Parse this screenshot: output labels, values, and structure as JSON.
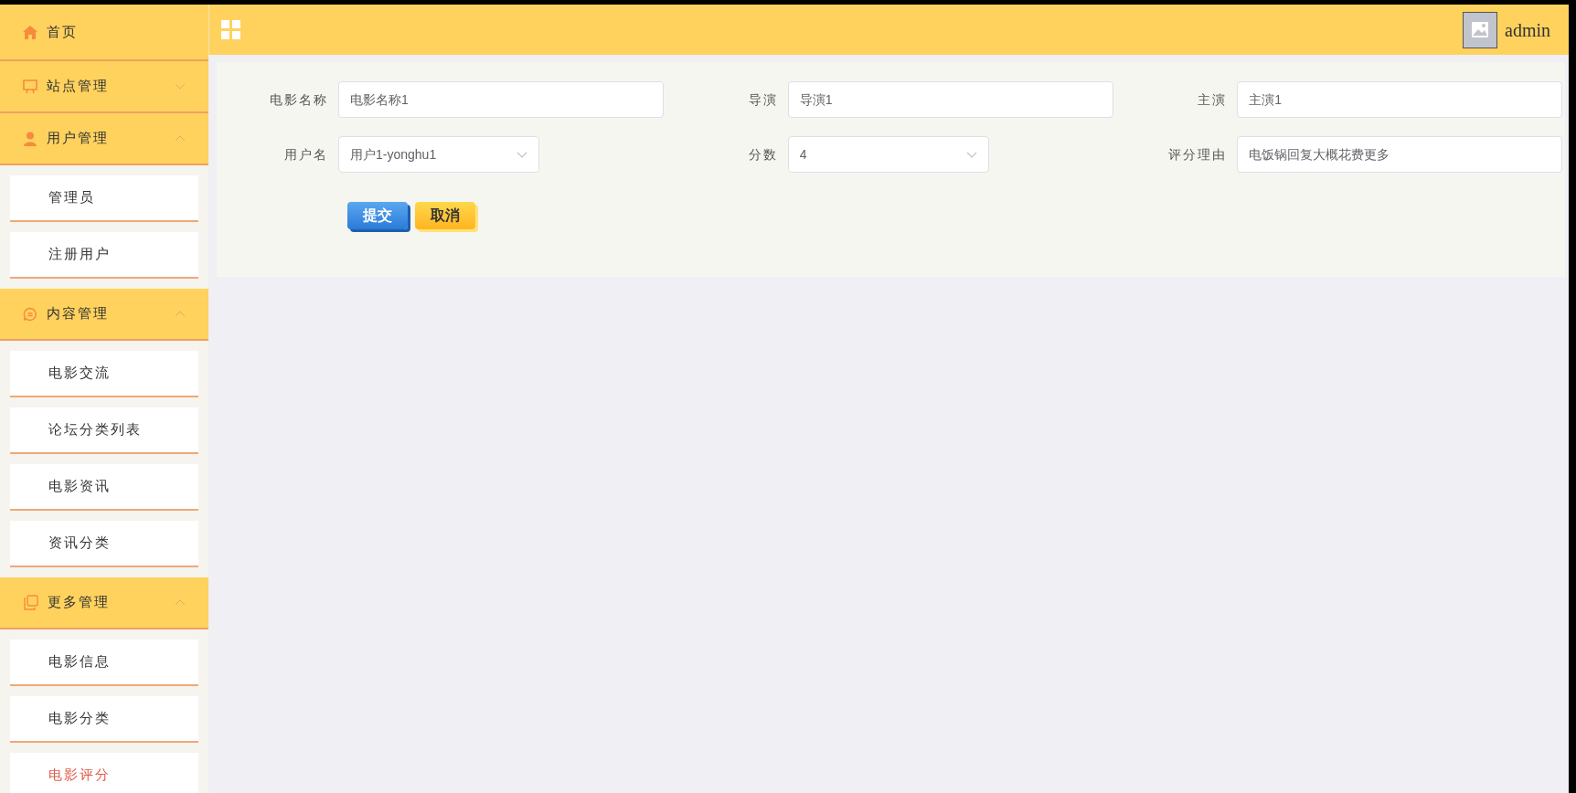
{
  "sidebar": {
    "items": [
      {
        "kind": "link",
        "label": "首页"
      },
      {
        "kind": "group",
        "label": "站点管理",
        "expanded": false
      },
      {
        "kind": "group",
        "label": "用户管理",
        "expanded": true,
        "children": [
          {
            "label": "管理员",
            "selected": false
          },
          {
            "label": "注册用户",
            "selected": false
          }
        ]
      },
      {
        "kind": "group",
        "label": "内容管理",
        "expanded": true,
        "children": [
          {
            "label": "电影交流",
            "selected": false
          },
          {
            "label": "论坛分类列表",
            "selected": false
          },
          {
            "label": "电影资讯",
            "selected": false
          },
          {
            "label": "资讯分类",
            "selected": false
          }
        ]
      },
      {
        "kind": "group",
        "label": "更多管理",
        "expanded": true,
        "children": [
          {
            "label": "电影信息",
            "selected": false
          },
          {
            "label": "电影分类",
            "selected": false
          },
          {
            "label": "电影评分",
            "selected": true
          }
        ]
      }
    ]
  },
  "header": {
    "user": "admin"
  },
  "form": {
    "rows": [
      [
        {
          "kind": "input",
          "label": "电影名称",
          "value": "电影名称1"
        },
        {
          "kind": "input",
          "label": "导演",
          "value": "导演1"
        },
        {
          "kind": "input",
          "label": "主演",
          "value": "主演1"
        }
      ],
      [
        {
          "kind": "select",
          "label": "用户名",
          "value": "用户1-yonghu1"
        },
        {
          "kind": "select",
          "label": "分数",
          "value": "4"
        },
        {
          "kind": "input",
          "label": "评分理由",
          "value": "电饭锅回复大概花费更多"
        }
      ]
    ],
    "buttons": [
      {
        "kind": "submit",
        "label": "提交"
      },
      {
        "kind": "cancel",
        "label": "取消"
      }
    ]
  }
}
